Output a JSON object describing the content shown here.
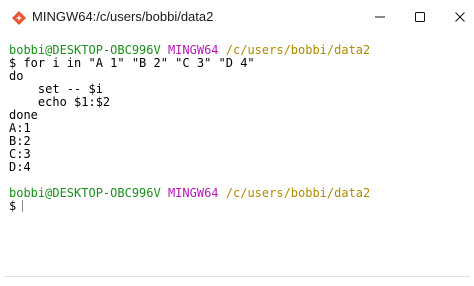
{
  "window": {
    "title": "MINGW64:/c/users/bobbi/data2"
  },
  "terminal": {
    "prompt1": {
      "user": "bobbi@DESKTOP-OBC996V",
      "env": "MINGW64",
      "path": "/c/users/bobbi/data2"
    },
    "lines": [
      "$ for i in \"A 1\" \"B 2\" \"C 3\" \"D 4\"",
      "do",
      "    set -- $i",
      "    echo $1:$2",
      "done",
      "A:1",
      "B:2",
      "C:3",
      "D:4"
    ],
    "prompt2": {
      "user": "bobbi@DESKTOP-OBC996V",
      "env": "MINGW64",
      "path": "/c/users/bobbi/data2"
    },
    "input_prefix": "$"
  },
  "colors": {
    "user": "#1a8f1a",
    "env": "#b519b5",
    "path": "#b08a00"
  }
}
